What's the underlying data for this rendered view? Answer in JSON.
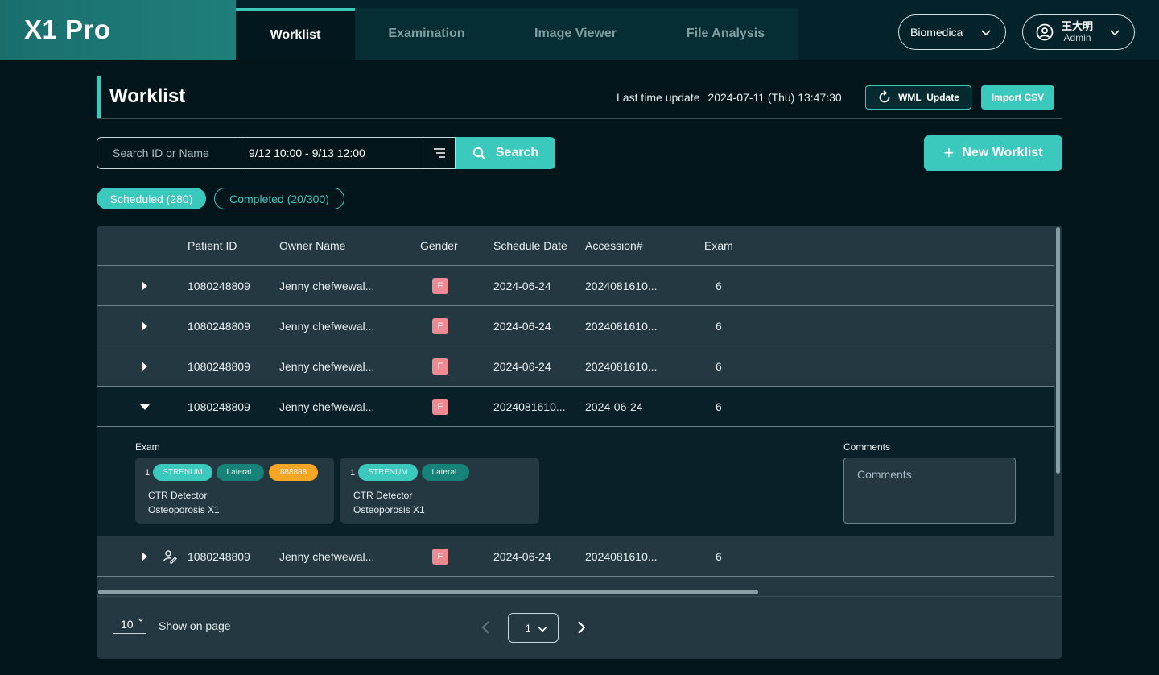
{
  "app": {
    "brand": "X1 Pro"
  },
  "nav": {
    "tabs": [
      {
        "label": "Worklist",
        "active": true
      },
      {
        "label": "Examination",
        "active": false
      },
      {
        "label": "Image Viewer",
        "active": false
      },
      {
        "label": "File Analysis",
        "active": false
      }
    ]
  },
  "org_select": {
    "value": "Biomedica"
  },
  "user": {
    "name": "王大明",
    "role": "Admin"
  },
  "page": {
    "title": "Worklist",
    "last_update_label": "Last time update",
    "last_update_value": "2024-07-11 (Thu) 13:47:30",
    "wml_update_label": "WML  Update",
    "import_csv_label": "Import CSV"
  },
  "search": {
    "placeholder": "Search ID or Name",
    "date_range": "9/12 10:00 - 9/13 12:00",
    "button_label": "Search",
    "new_worklist_label": "New Worklist"
  },
  "filters": {
    "scheduled": "Scheduled (280)",
    "completed": "Completed (20/300)"
  },
  "table": {
    "columns": [
      "Patient ID",
      "Owner Name",
      "Gender",
      "Schedule Date",
      "Accession#",
      "Exam"
    ],
    "rows": [
      {
        "patient_id": "1080248809",
        "owner": "Jenny chefwewal...",
        "gender": "F",
        "col4": "2024-06-24",
        "col5": "2024081610...",
        "exam": "6"
      },
      {
        "patient_id": "1080248809",
        "owner": "Jenny chefwewal...",
        "gender": "F",
        "col4": "2024-06-24",
        "col5": "2024081610...",
        "exam": "6"
      },
      {
        "patient_id": "1080248809",
        "owner": "Jenny chefwewal...",
        "gender": "F",
        "col4": "2024-06-24",
        "col5": "2024081610...",
        "exam": "6"
      },
      {
        "patient_id": "1080248809",
        "owner": "Jenny chefwewal...",
        "gender": "F",
        "col4": "2024081610...",
        "col5": "2024-06-24",
        "exam": "6"
      },
      {
        "patient_id": "1080248809",
        "owner": "Jenny chefwewal...",
        "gender": "F",
        "col4": "2024-06-24",
        "col5": "2024081610...",
        "exam": "6"
      }
    ],
    "expanded": {
      "exam_label": "Exam",
      "comments_label": "Comments",
      "comments_placeholder": "Comments",
      "cards": [
        {
          "index": "1",
          "tags": [
            "STRENUM",
            "LateraL",
            "888888"
          ],
          "line1": "CTR Detector",
          "line2": "Osteoporosis X1"
        },
        {
          "index": "1",
          "tags": [
            "STRENUM",
            "LateraL"
          ],
          "line1": "CTR Detector",
          "line2": "Osteoporosis X1"
        }
      ]
    }
  },
  "pagination": {
    "page_size": "10",
    "show_label": "Show on page",
    "current_page": "1"
  },
  "colors": {
    "accent": "#3cc9bd",
    "background": "#02151b",
    "table_bg": "#243842",
    "gender_female": "#f08a92",
    "tag_orange": "#f5a623"
  }
}
